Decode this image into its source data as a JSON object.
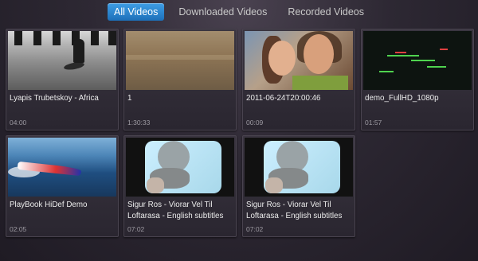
{
  "tabs": [
    {
      "label": "All Videos",
      "active": true
    },
    {
      "label": "Downloaded Videos",
      "active": false
    },
    {
      "label": "Recorded Videos",
      "active": false
    }
  ],
  "videos": [
    {
      "title": "Lyapis Trubetskoy - Africa",
      "duration": "04:00",
      "thumbnail": "man-bw-field"
    },
    {
      "title": "1",
      "duration": "1:30:33",
      "thumbnail": "brown-ground"
    },
    {
      "title": "2011-06-24T20:00:46",
      "duration": "00:09",
      "thumbnail": "couple-selfie"
    },
    {
      "title": "demo_FullHD_1080p",
      "duration": "01:57",
      "thumbnail": "dark-demo-lights"
    },
    {
      "title": "PlayBook HiDef Demo",
      "duration": "02:05",
      "thumbnail": "speedboat"
    },
    {
      "title": "Sigur Ros - Viorar Vel Til Loftarasa - English subtitles",
      "duration": "07:02",
      "thumbnail": "baby-screen"
    },
    {
      "title": "Sigur Ros - Viorar Vel Til Loftarasa - English subtitles",
      "duration": "07:02",
      "thumbnail": "baby-screen"
    }
  ],
  "colors": {
    "accent": "#2a86d0",
    "background": "#2d2833"
  }
}
